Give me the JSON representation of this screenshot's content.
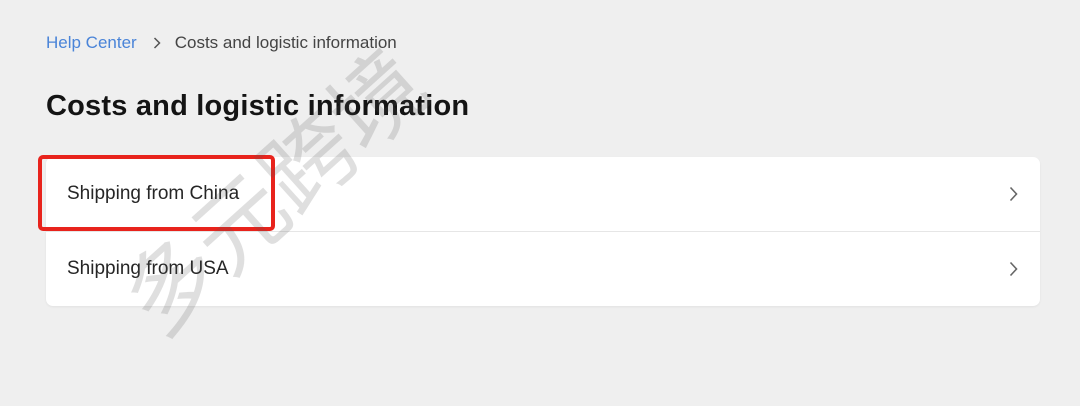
{
  "breadcrumb": {
    "home_label": "Help Center",
    "current_label": "Costs and logistic information"
  },
  "page": {
    "title": "Costs and logistic information"
  },
  "list": {
    "items": [
      {
        "label": "Shipping from China"
      },
      {
        "label": "Shipping from USA"
      }
    ]
  },
  "overlay": {
    "highlight_color": "#e8231c",
    "watermark_text": "多元跨境"
  },
  "colors": {
    "link": "#4a84d8",
    "background": "#efefef"
  }
}
